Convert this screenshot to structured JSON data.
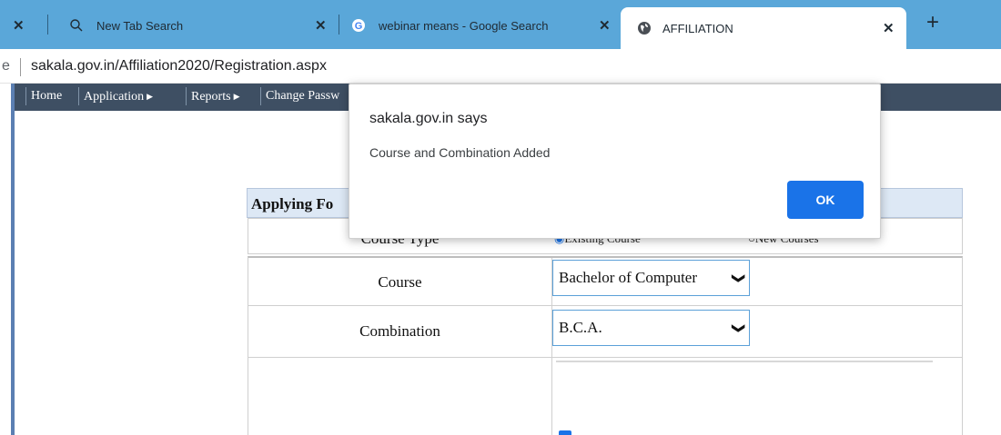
{
  "browser": {
    "tabs": [
      {
        "title": "New Tab Search",
        "icon": "search-icon"
      },
      {
        "title": "webinar means - Google Search",
        "icon": "google-icon"
      },
      {
        "title": "AFFILIATION",
        "icon": "globe-icon"
      }
    ],
    "url": "sakala.gov.in/Affiliation2020/Registration.aspx",
    "omnibox_prefix": "e"
  },
  "nav": {
    "items": [
      "Home",
      "Application",
      "Reports",
      "Change Passw"
    ]
  },
  "form": {
    "header": "Applying Fo",
    "course_type_label": "Course Type",
    "radio_existing": "Existing Course",
    "radio_new": "New Courses",
    "course_label": "Course",
    "course_value": "Bachelor of Computer",
    "combination_label": "Combination",
    "combination_value": "B.C.A."
  },
  "dialog": {
    "title": "sakala.gov.in says",
    "message": "Course and Combination Added",
    "ok_label": "OK"
  },
  "colors": {
    "tabstrip": "#5aa7d9",
    "navbar": "#3e4f63",
    "accent": "#1a73e8"
  }
}
